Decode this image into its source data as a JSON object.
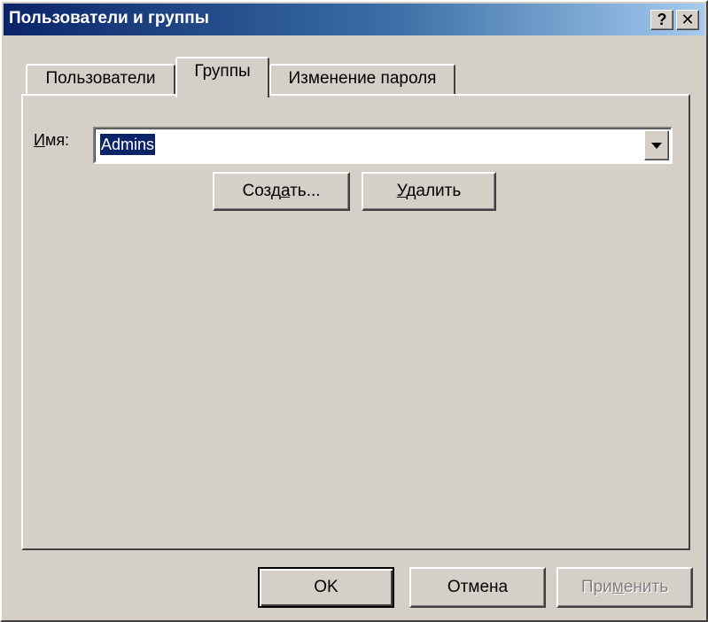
{
  "window": {
    "title": "Пользователи и группы",
    "help_glyph": "?",
    "close_glyph": "✕"
  },
  "tabs": [
    {
      "label": "Пользователи",
      "active": false
    },
    {
      "label": "Группы",
      "active": true
    },
    {
      "label": "Изменение пароля",
      "active": false
    }
  ],
  "groups": {
    "name_label_accel": "И",
    "name_label_rest": "мя:",
    "name_value": "Admins",
    "create_pre": "Созд",
    "create_accel": "а",
    "create_post": "ть...",
    "delete_accel": "У",
    "delete_post": "далить"
  },
  "footer": {
    "ok_label": "OK",
    "cancel_label": "Отмена",
    "apply_pre": "При",
    "apply_accel": "м",
    "apply_post": "енить",
    "apply_disabled": true
  },
  "colors": {
    "titlebar_start": "#0a246a",
    "titlebar_end": "#a6caf0",
    "face": "#d4d0c8",
    "selection": "#0a246a"
  }
}
